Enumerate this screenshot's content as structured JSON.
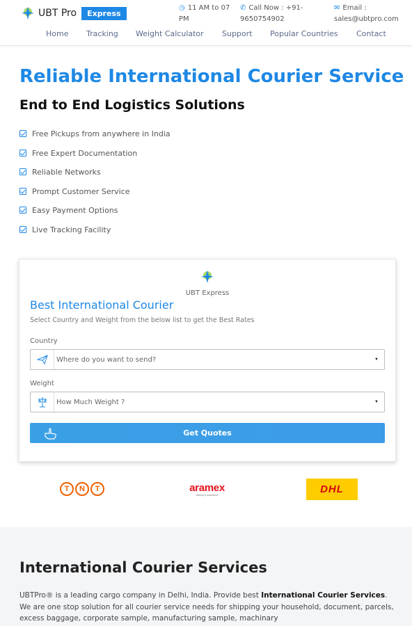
{
  "header": {
    "brand": "UBT Pro",
    "badge": "Express",
    "hours": "11 AM to 07 PM",
    "phone": "Call Now : +91-9650754902",
    "email": "Email : sales@ubtpro.com"
  },
  "nav": {
    "items": [
      {
        "label": "Home"
      },
      {
        "label": "Tracking"
      },
      {
        "label": "Weight Calculator"
      },
      {
        "label": "Support"
      },
      {
        "label": "Popular Countries"
      },
      {
        "label": "Contact"
      }
    ]
  },
  "hero": {
    "title": "Reliable International Courier Service",
    "subtitle": "End to End Logistics Solutions",
    "features": [
      "Free Pickups from anywhere in India",
      "Free Expert Documentation",
      "Reliable Networks",
      "Prompt Customer Service",
      "Easy Payment Options",
      "Live Tracking Facility"
    ]
  },
  "quote_form": {
    "logo_text": "UBT Express",
    "title": "Best International Courier",
    "description": "Select Country and Weight from the below list to get the Best Rates",
    "country_label": "Country",
    "country_placeholder": "Where do you want to send?",
    "weight_label": "Weight",
    "weight_placeholder": "How Much Weight ?",
    "button_label": "Get Quotes"
  },
  "carriers": {
    "tnt": [
      "T",
      "N",
      "T"
    ],
    "aramex": "aramex",
    "aramex_tagline": "delivery unlimited",
    "dhl": "DHL"
  },
  "services": {
    "title": "International Courier Services",
    "text_1": "UBTPro® is a leading cargo company in Delhi, India. Provide best ",
    "text_bold": "International Courier Services",
    "text_2": ". We are one stop solution for all courier service needs for shipping your household, document, parcels, excess baggage, corporate sample, manufacturing sample, machinary"
  },
  "colors": {
    "accent": "#1e88e5",
    "button": "#3d9be8",
    "tnt": "#f06000",
    "aramex": "#e3121b",
    "dhl_bg": "#ffcc00",
    "dhl_text": "#d40511"
  },
  "icons": {
    "hours": "clock-icon",
    "phone": "phone-icon",
    "email": "envelope-icon",
    "country": "paper-plane-icon",
    "weight": "scale-icon",
    "button": "hand-pointer-icon",
    "feature": "checkbox-icon"
  }
}
